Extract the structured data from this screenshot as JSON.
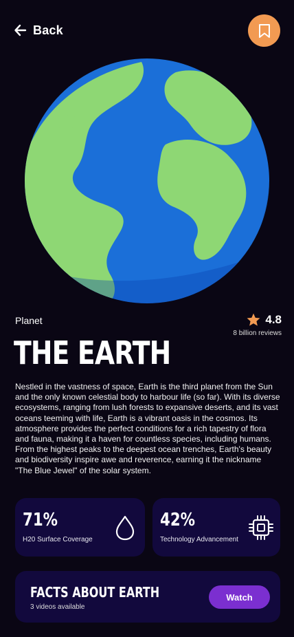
{
  "header": {
    "back_label": "Back",
    "bookmark_icon": "bookmark-icon"
  },
  "hero": {
    "image": "earth-globe-illustration",
    "colors": {
      "ocean": "#1b6fd8",
      "land": "#8ed774",
      "shadow": "#0d57c9"
    }
  },
  "planet": {
    "category": "Planet",
    "name": "THE EARTH",
    "rating": "4.8",
    "reviews": "8 billion reviews",
    "description": "Nestled in the vastness of space, Earth is the third planet from the Sun and the only known celestial body to harbour life (so far). With its diverse ecosystems, ranging from lush forests to expansive deserts, and its vast oceans teeming with life, Earth is a vibrant oasis in the cosmos. Its atmosphere provides the perfect conditions for a rich tapestry of flora and fauna, making it a haven for countless species, including humans. From the highest peaks to the deepest ocean trenches, Earth's beauty and biodiversity inspire awe and reverence, earning it the nickname \"The Blue Jewel\" of the solar system."
  },
  "stats": [
    {
      "value": "71%",
      "label": "H20 Surface Coverage",
      "icon": "water-drop-icon"
    },
    {
      "value": "42%",
      "label": "Technology Advancement",
      "icon": "chip-icon"
    }
  ],
  "facts": {
    "title": "FACTS ABOUT EARTH",
    "subtitle": "3 videos available",
    "button_label": "Watch"
  },
  "theme": {
    "background": "#0a0614",
    "card": "#12093d",
    "accent_orange": "#f29a52",
    "accent_purple": "#7b2fd0"
  }
}
